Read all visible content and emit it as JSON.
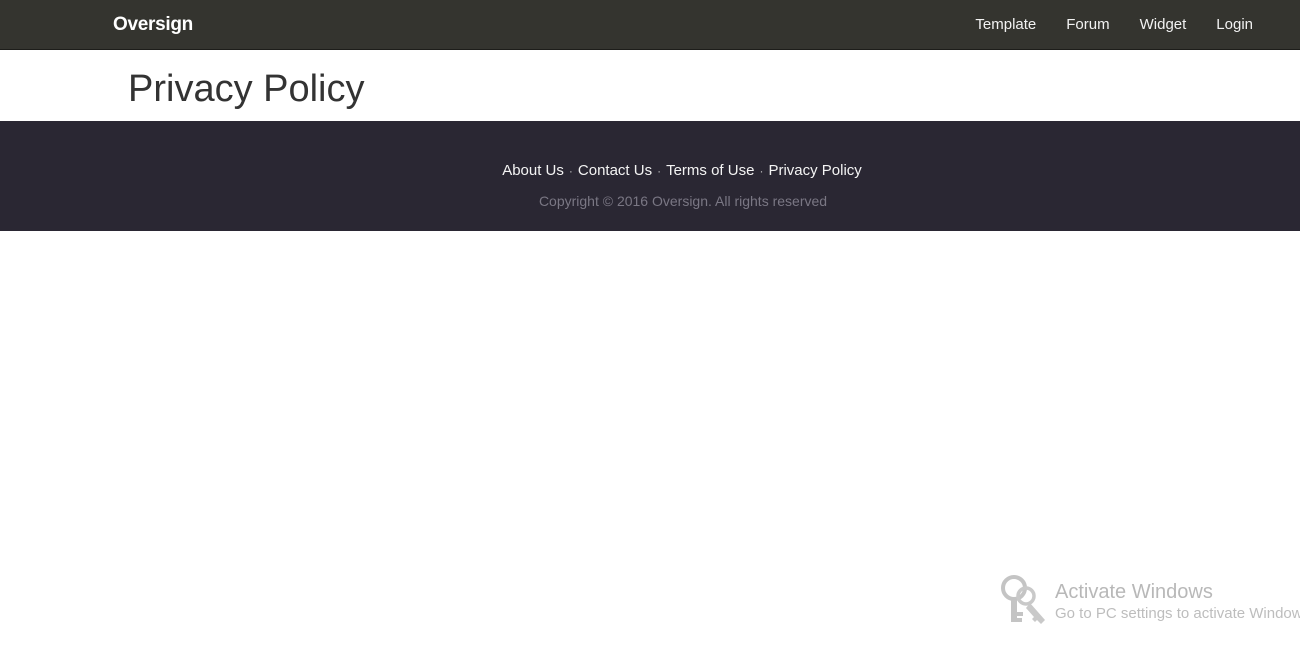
{
  "navbar": {
    "brand": "Oversign",
    "links": [
      "Template",
      "Forum",
      "Widget",
      "Login"
    ]
  },
  "page": {
    "title": "Privacy Policy"
  },
  "footer": {
    "links": [
      "About Us",
      "Contact Us",
      "Terms of Use",
      "Privacy Policy"
    ],
    "separator": "·",
    "copyright": "Copyright © 2016 Oversign. All rights reserved"
  },
  "watermark": {
    "title": "Activate Windows",
    "subtitle": "Go to PC settings to activate Windows",
    "icon": "key-icon"
  },
  "colors": {
    "navbar_bg": "#34342f",
    "footer_bg": "#2a2733",
    "copyright_text": "#7a7784"
  }
}
